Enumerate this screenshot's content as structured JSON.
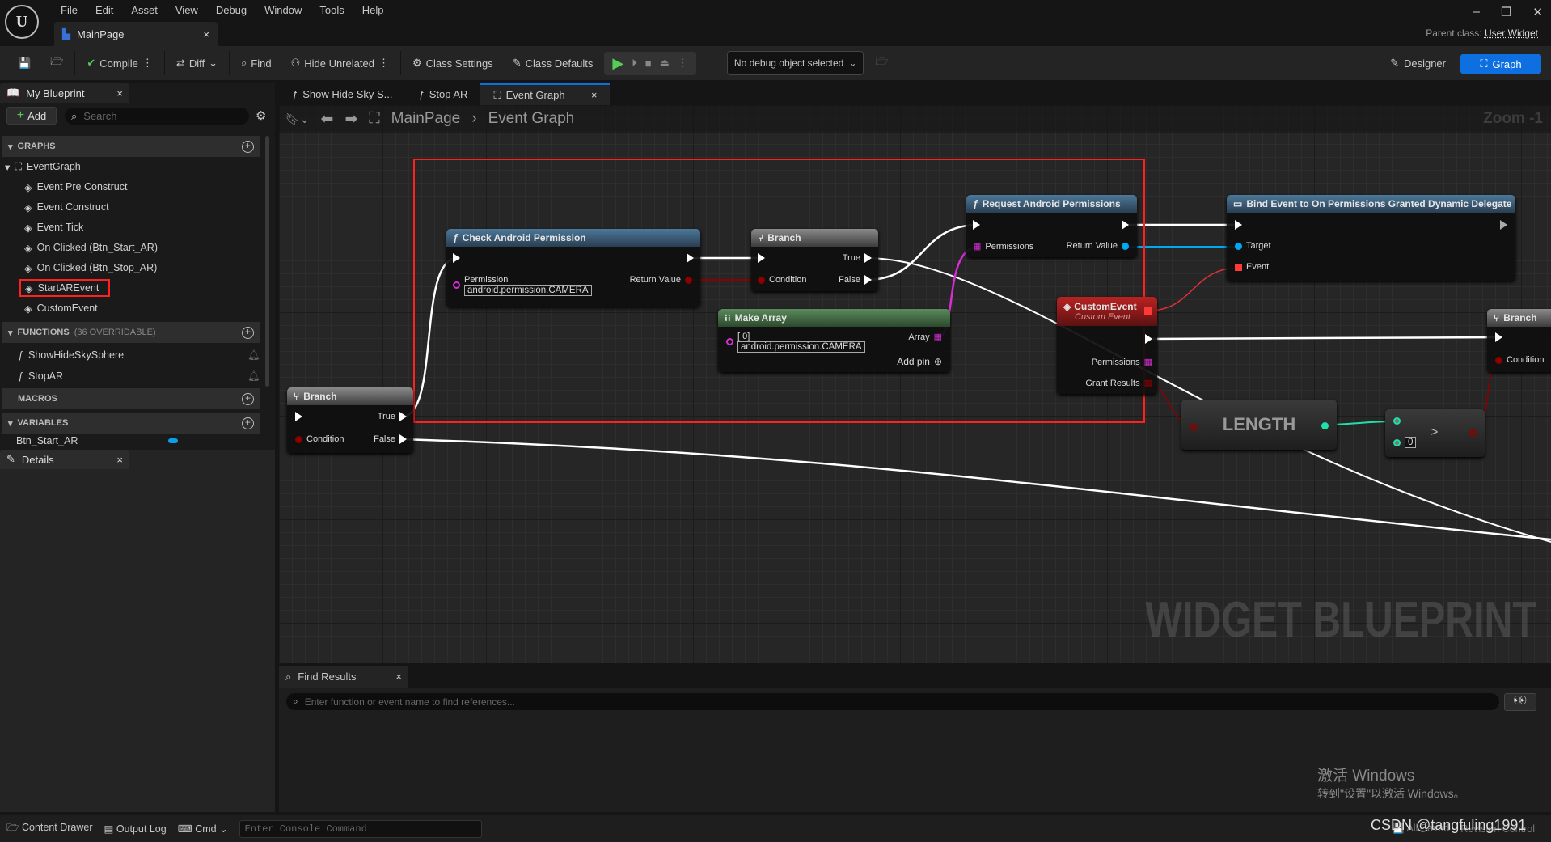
{
  "menu": [
    "File",
    "Edit",
    "Asset",
    "View",
    "Debug",
    "Window",
    "Tools",
    "Help"
  ],
  "doc_tab": "MainPage",
  "parent_class_label": "Parent class:",
  "parent_class": "User Widget",
  "toolbar": {
    "compile": "Compile",
    "diff": "Diff",
    "find": "Find",
    "hide_unrelated": "Hide Unrelated",
    "class_settings": "Class Settings",
    "class_defaults": "Class Defaults",
    "debug_object": "No debug object selected",
    "designer": "Designer",
    "graph": "Graph"
  },
  "left_panel": {
    "tab": "My Blueprint",
    "add": "Add",
    "search_placeholder": "Search",
    "graphs_header": "GRAPHS",
    "event_graph": "EventGraph",
    "events": [
      "Event Pre Construct",
      "Event Construct",
      "Event Tick",
      "On Clicked (Btn_Start_AR)",
      "On Clicked (Btn_Stop_AR)",
      "StartAREvent",
      "CustomEvent"
    ],
    "functions_header": "FUNCTIONS",
    "functions_note": "(36 OVERRIDABLE)",
    "functions": [
      "ShowHideSkySphere",
      "StopAR"
    ],
    "macros_header": "MACROS",
    "variables_header": "VARIABLES",
    "variables": [
      "Btn_Start_AR"
    ],
    "details_tab": "Details"
  },
  "graph_tabs": [
    {
      "label": "Show Hide Sky S..."
    },
    {
      "label": "Stop AR"
    },
    {
      "label": "Event Graph"
    }
  ],
  "breadcrumb": [
    "MainPage",
    "Event Graph"
  ],
  "zoom": "Zoom -1",
  "watermark": "WIDGET BLUEPRINT",
  "nodes": {
    "check": {
      "title": "Check Android Permission",
      "permission": "Permission",
      "value": "android.permission.CAMERA",
      "return": "Return Value"
    },
    "branch": {
      "title": "Branch",
      "true": "True",
      "false": "False",
      "condition": "Condition"
    },
    "make_array": {
      "title": "Make Array",
      "index": "[ 0]",
      "value": "android.permission.CAMERA",
      "array": "Array",
      "add_pin": "Add pin"
    },
    "request": {
      "title": "Request Android Permissions",
      "permissions": "Permissions",
      "return": "Return Value"
    },
    "bind": {
      "title": "Bind Event to On Permissions Granted Dynamic Delegate",
      "target": "Target",
      "event": "Event"
    },
    "custom": {
      "title": "CustomEvent",
      "subtitle": "Custom Event",
      "permissions": "Permissions",
      "grant": "Grant Results"
    },
    "length": {
      "title": "LENGTH"
    },
    "greater": {
      "op": ">",
      "value": "0"
    }
  },
  "colors": {
    "exec": "#ffffff",
    "bool": "#8b0000",
    "string": "#d42ed4",
    "object": "#00a8f0",
    "delegate": "#ff3838",
    "int": "#1fe0a8",
    "highlight": "#ff2020",
    "accent": "#0e70e0"
  },
  "find": {
    "tab": "Find Results",
    "placeholder": "Enter function or event name to find references..."
  },
  "status": {
    "content_drawer": "Content Drawer",
    "output_log": "Output Log",
    "cmd": "Cmd",
    "console_placeholder": "Enter Console Command",
    "saved": "All Saved",
    "revision": "Revision Control"
  },
  "windows": {
    "line1": "激活 Windows",
    "line2": "转到\"设置\"以激活 Windows。"
  },
  "credit": "CSDN @tangfuling1991"
}
